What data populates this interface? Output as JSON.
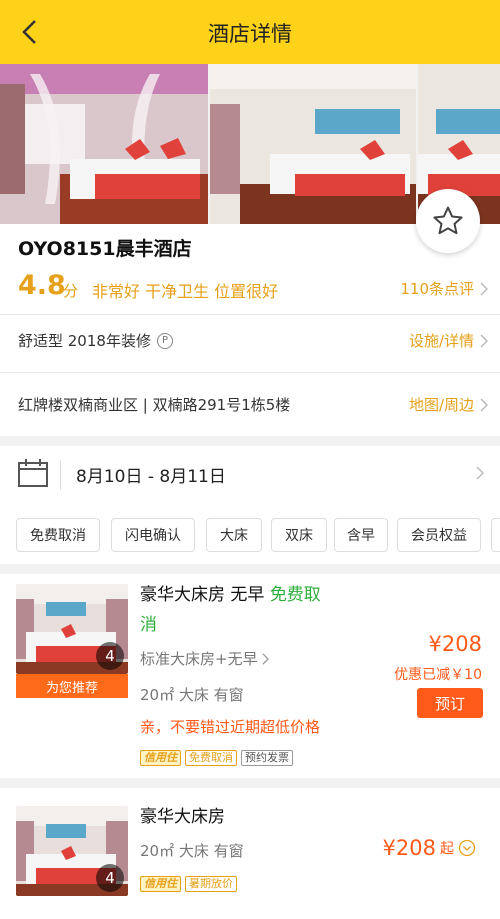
{
  "header": {
    "title": "酒店详情"
  },
  "hotel": {
    "name": "OYO8151晨丰酒店",
    "score": "4.8",
    "score_unit": "分",
    "score_tags": "非常好 干净卫生 位置很好",
    "review_link": "110条点评",
    "type_text": "舒适型 2018年装修",
    "facility_link": "设施/详情",
    "address": "红牌楼双楠商业区 | 双楠路291号1栋5楼",
    "map_link": "地图/周边"
  },
  "dates": {
    "range": "8月10日 - 8月11日"
  },
  "filters": [
    "免费取消",
    "闪电确认",
    "大床",
    "双床",
    "含早",
    "会员权益"
  ],
  "rooms": [
    {
      "title_main": "豪华大床房 无早",
      "title_cancel": "免费取",
      "title_cancel2": "消",
      "image_count": "4",
      "recommend_label": "为您推荐",
      "subtype": "标准大床房+无早",
      "specs": "20㎡ 大床 有窗",
      "promo": "亲，不要错过近期超低价格",
      "tags": [
        "信用住",
        "免费取消",
        "预约发票"
      ],
      "price": "¥208",
      "discount": "优惠已减￥10",
      "book_label": "预订"
    },
    {
      "title_main": "豪华大床房",
      "image_count": "4",
      "specs": "20㎡ 大床 有窗",
      "tags": [
        "信用住",
        "暑期放价"
      ],
      "price": "¥208",
      "price_suffix": "起"
    }
  ],
  "colors": {
    "header": "#ffd21a",
    "accent": "#e6a01a",
    "price": "#ff5a1a",
    "green": "#2fae3b"
  }
}
